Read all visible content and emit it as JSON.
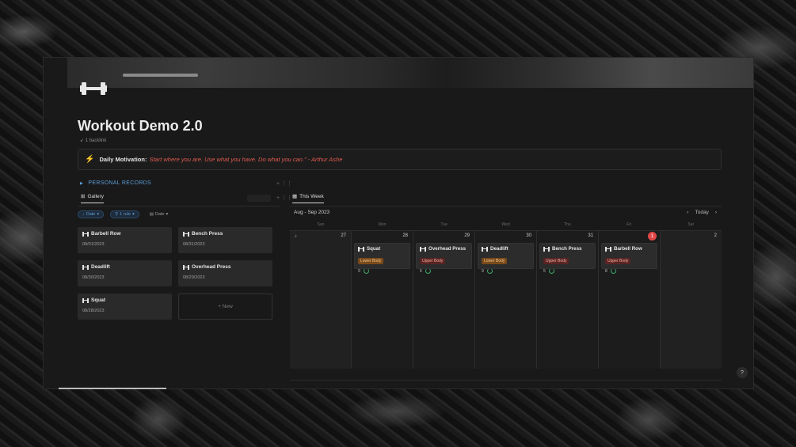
{
  "page": {
    "title": "Workout Demo 2.0",
    "backlink": "1 backlink",
    "callout_label": "Daily Motivation:",
    "callout_quote": "Start where you are. Use what you have. Do what you can.\" - Arthur Ashe"
  },
  "records": {
    "toggle_label": "PERSONAL RECORDS",
    "gallery_tab": "Gallery",
    "filters": [
      "Date",
      "1 rule",
      "Date"
    ],
    "cards": [
      {
        "name": "Barbell Row",
        "date": "09/01/2023"
      },
      {
        "name": "Bench Press",
        "date": "08/31/2023"
      },
      {
        "name": "Deadlift",
        "date": "08/30/2023"
      },
      {
        "name": "Overhead Press",
        "date": "08/29/2023"
      },
      {
        "name": "Squat",
        "date": "08/28/2023"
      }
    ],
    "new_label": "+ New"
  },
  "calendar": {
    "tab": "This Week",
    "range": "Aug - Sep 2023",
    "today_label": "Today",
    "weekdays": [
      "Sun",
      "Mon",
      "Tue",
      "Wed",
      "Thu",
      "Fri",
      "Sat"
    ],
    "days": [
      "27",
      "28",
      "29",
      "30",
      "31",
      "1",
      "2"
    ],
    "events": [
      {
        "name": "Squat",
        "tag": "Lower Body",
        "count": "9"
      },
      {
        "name": "Overhead Press",
        "tag": "Upper Body",
        "count": "6"
      },
      {
        "name": "Deadlift",
        "tag": "Lower Body",
        "count": "9"
      },
      {
        "name": "Bench Press",
        "tag": "Upper Body",
        "count": "5"
      },
      {
        "name": "Barbell Row",
        "tag": "Upper Body",
        "count": "8"
      }
    ]
  },
  "help_label": "?"
}
